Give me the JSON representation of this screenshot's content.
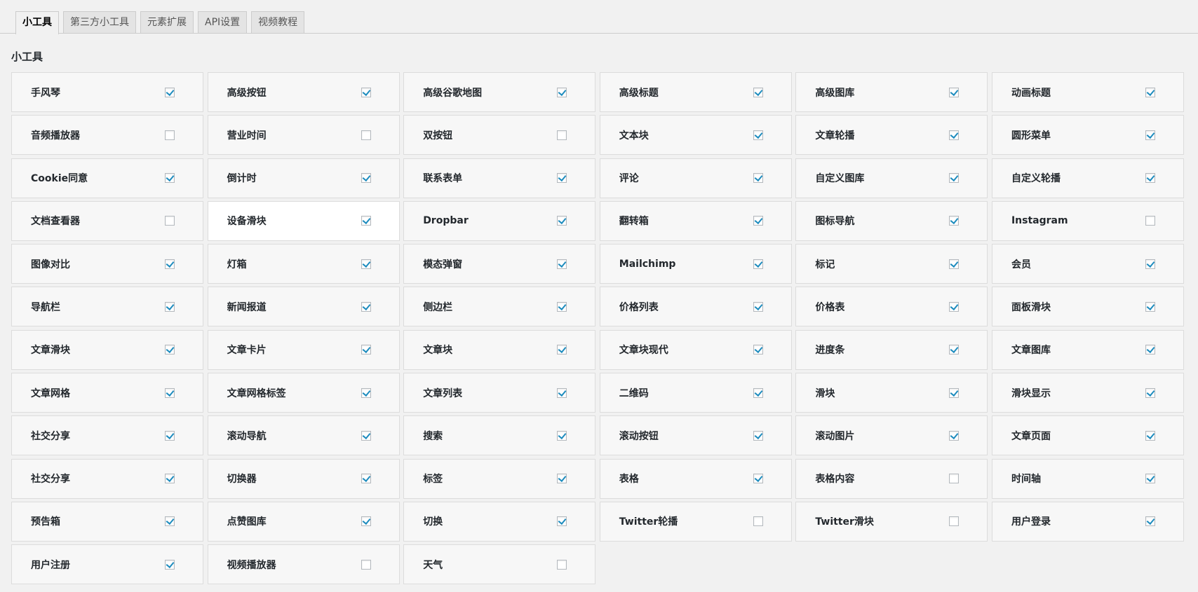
{
  "tabs": [
    {
      "label": "小工具",
      "active": true
    },
    {
      "label": "第三方小工具",
      "active": false
    },
    {
      "label": "元素扩展",
      "active": false
    },
    {
      "label": "API设置",
      "active": false
    },
    {
      "label": "视频教程",
      "active": false
    }
  ],
  "section_title": "小工具",
  "accent_color": "#1e8cbe",
  "widgets": [
    {
      "label": "手风琴",
      "checked": true
    },
    {
      "label": "高级按钮",
      "checked": true
    },
    {
      "label": "高级谷歌地图",
      "checked": true
    },
    {
      "label": "高级标题",
      "checked": true
    },
    {
      "label": "高级图库",
      "checked": true
    },
    {
      "label": "动画标题",
      "checked": true
    },
    {
      "label": "音频播放器",
      "checked": false
    },
    {
      "label": "营业时间",
      "checked": false
    },
    {
      "label": "双按钮",
      "checked": false
    },
    {
      "label": "文本块",
      "checked": true
    },
    {
      "label": "文章轮播",
      "checked": true
    },
    {
      "label": "圆形菜单",
      "checked": true
    },
    {
      "label": "Cookie同意",
      "checked": true
    },
    {
      "label": "倒计时",
      "checked": true
    },
    {
      "label": "联系表单",
      "checked": true
    },
    {
      "label": "评论",
      "checked": true
    },
    {
      "label": "自定义图库",
      "checked": true
    },
    {
      "label": "自定义轮播",
      "checked": true
    },
    {
      "label": "文档查看器",
      "checked": false
    },
    {
      "label": "设备滑块",
      "checked": true,
      "highlight": true
    },
    {
      "label": "Dropbar",
      "checked": true
    },
    {
      "label": "翻转箱",
      "checked": true
    },
    {
      "label": "图标导航",
      "checked": true
    },
    {
      "label": "Instagram",
      "checked": false
    },
    {
      "label": "图像对比",
      "checked": true
    },
    {
      "label": "灯箱",
      "checked": true
    },
    {
      "label": "模态弹窗",
      "checked": true
    },
    {
      "label": "Mailchimp",
      "checked": true
    },
    {
      "label": "标记",
      "checked": true
    },
    {
      "label": "会员",
      "checked": true
    },
    {
      "label": "导航栏",
      "checked": true
    },
    {
      "label": "新闻报道",
      "checked": true
    },
    {
      "label": "侧边栏",
      "checked": true
    },
    {
      "label": "价格列表",
      "checked": true
    },
    {
      "label": "价格表",
      "checked": true
    },
    {
      "label": "面板滑块",
      "checked": true
    },
    {
      "label": "文章滑块",
      "checked": true
    },
    {
      "label": "文章卡片",
      "checked": true
    },
    {
      "label": "文章块",
      "checked": true
    },
    {
      "label": "文章块现代",
      "checked": true
    },
    {
      "label": "进度条",
      "checked": true
    },
    {
      "label": "文章图库",
      "checked": true
    },
    {
      "label": "文章网格",
      "checked": true
    },
    {
      "label": "文章网格标签",
      "checked": true
    },
    {
      "label": "文章列表",
      "checked": true
    },
    {
      "label": "二维码",
      "checked": true
    },
    {
      "label": "滑块",
      "checked": true
    },
    {
      "label": "滑块显示",
      "checked": true
    },
    {
      "label": "社交分享",
      "checked": true
    },
    {
      "label": "滚动导航",
      "checked": true
    },
    {
      "label": "搜索",
      "checked": true
    },
    {
      "label": "滚动按钮",
      "checked": true
    },
    {
      "label": "滚动图片",
      "checked": true
    },
    {
      "label": "文章页面",
      "checked": true
    },
    {
      "label": "社交分享",
      "checked": true
    },
    {
      "label": "切换器",
      "checked": true
    },
    {
      "label": "标签",
      "checked": true
    },
    {
      "label": "表格",
      "checked": true
    },
    {
      "label": "表格内容",
      "checked": false
    },
    {
      "label": "时间轴",
      "checked": true
    },
    {
      "label": "预告箱",
      "checked": true
    },
    {
      "label": "点赞图库",
      "checked": true
    },
    {
      "label": "切换",
      "checked": true
    },
    {
      "label": "Twitter轮播",
      "checked": false
    },
    {
      "label": "Twitter滑块",
      "checked": false
    },
    {
      "label": "用户登录",
      "checked": true
    },
    {
      "label": "用户注册",
      "checked": true
    },
    {
      "label": "视频播放器",
      "checked": false
    },
    {
      "label": "天气",
      "checked": false
    }
  ]
}
